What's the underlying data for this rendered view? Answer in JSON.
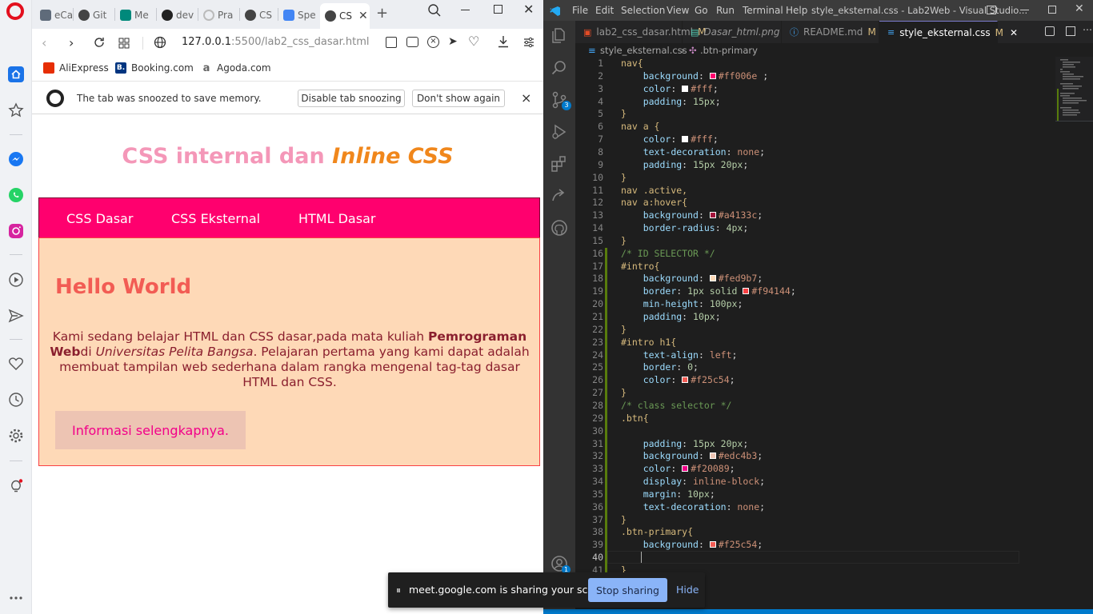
{
  "browser": {
    "tabs": [
      {
        "label": "eCa",
        "color": "#5f6b7a"
      },
      {
        "label": "Git",
        "color": "#444"
      },
      {
        "label": "Me",
        "color": "#00897b"
      },
      {
        "label": "dev",
        "color": "#222"
      },
      {
        "label": "Pra",
        "color": "#999"
      },
      {
        "label": "CS",
        "color": "#444"
      },
      {
        "label": "Spe",
        "color": "#4285f4"
      },
      {
        "label": "CS",
        "color": "#444"
      }
    ],
    "address": {
      "host": "127.0.0.1",
      "rest": ":5500/lab2_css_dasar.html"
    },
    "bookmarks": [
      {
        "label": "AliExpress",
        "icon_color": "#e62e04",
        "letter": "a"
      },
      {
        "label": "Booking.com",
        "icon_color": "#003580",
        "letter": "B."
      },
      {
        "label": "Agoda.com",
        "icon_color": "#777777",
        "letter": "a"
      }
    ],
    "snooze": {
      "message": "The tab was snoozed to save memory.",
      "disable_label": "Disable tab snoozing",
      "dont_show_label": "Don't show again",
      "close_label": "×"
    }
  },
  "page": {
    "title_part1": "CSS internal dan ",
    "title_part2": "Inline CSS",
    "nav": [
      "CSS Dasar",
      "CSS Eksternal",
      "HTML Dasar"
    ],
    "intro_heading": "Hello World",
    "intro_text_1": "Kami sedang belajar HTML dan CSS dasar,pada mata kuliah ",
    "intro_bold": "Pemrograman Web",
    "intro_text_2": "di ",
    "intro_italic": "Universitas Pelita Bangsa",
    "intro_text_3": ". Pelajaran pertama yang kami dapat adalah membuat tampilan web sederhana dalam rangka mengenal tag-tag dasar HTML dan CSS.",
    "intro_button": "Informasi selengkapnya."
  },
  "share": {
    "message": "meet.google.com is sharing your screen.",
    "stop_label": "Stop sharing",
    "hide_label": "Hide"
  },
  "vscode": {
    "menu": [
      "File",
      "Edit",
      "Selection",
      "View",
      "Go",
      "Run",
      "Terminal",
      "Help"
    ],
    "title": "style_eksternal.css - Lab2Web - Visual Studio...",
    "tabs": [
      {
        "label": "lab2_css_dasar.html",
        "mark": "M"
      },
      {
        "label": "Dasar_html.png",
        "mark": ""
      },
      {
        "label": "README.md",
        "mark": "M"
      },
      {
        "label": "style_eksternal.css",
        "mark": "M"
      }
    ],
    "breadcrumb": {
      "file": "style_eksternal.css",
      "symbol": ".btn-primary"
    },
    "source_control_badge": "3",
    "account_badge": "1",
    "lines": [
      [
        "sel",
        "nav{"
      ],
      [
        "decl",
        "background",
        "#ff006e",
        " ;",
        "#ff006e"
      ],
      [
        "decl",
        "color",
        "#fff",
        ";",
        "#ffffff"
      ],
      [
        "decl",
        "padding",
        "15px",
        ";",
        ""
      ],
      [
        "sel",
        "}"
      ],
      [
        "sel",
        "nav a {"
      ],
      [
        "decl",
        "color",
        "#fff",
        ";",
        "#ffffff"
      ],
      [
        "decl",
        "text-decoration",
        "none",
        ";",
        ""
      ],
      [
        "decl",
        "padding",
        "15px 20px",
        ";",
        ""
      ],
      [
        "sel",
        "}"
      ],
      [
        "sel",
        "nav .active,"
      ],
      [
        "sel",
        "nav a:hover{"
      ],
      [
        "decl",
        "background",
        "#a4133c",
        ";",
        "#a4133c"
      ],
      [
        "decl",
        "border-radius",
        "4px",
        ";",
        ""
      ],
      [
        "sel",
        "}"
      ],
      [
        "cmt",
        "/* ID SELECTOR */"
      ],
      [
        "sel",
        "#intro{"
      ],
      [
        "decl",
        "background",
        "#fed9b7",
        ";",
        "#fed9b7"
      ],
      [
        "decl",
        "border",
        "1px solid #f94144",
        ";",
        "#f94144"
      ],
      [
        "decl",
        "min-height",
        "100px",
        ";",
        ""
      ],
      [
        "decl",
        "padding",
        "10px",
        ";",
        ""
      ],
      [
        "sel",
        "}"
      ],
      [
        "sel",
        "#intro h1{"
      ],
      [
        "decl",
        "text-align",
        "left",
        ";",
        ""
      ],
      [
        "decl",
        "border",
        "0",
        ";",
        ""
      ],
      [
        "decl",
        "color",
        "#f25c54",
        ";",
        "#f25c54"
      ],
      [
        "sel",
        "}"
      ],
      [
        "cmt",
        "/* class selector */"
      ],
      [
        "sel",
        ".btn{"
      ],
      [
        "sel",
        ""
      ],
      [
        "decl",
        "padding",
        "15px 20px",
        ";",
        ""
      ],
      [
        "decl",
        "background",
        "#edc4b3",
        ";",
        "#edc4b3"
      ],
      [
        "decl",
        "color",
        "#f20089",
        ";",
        "#f20089"
      ],
      [
        "decl",
        "display",
        "inline-block",
        ";",
        ""
      ],
      [
        "decl",
        "margin",
        "10px",
        ";",
        ""
      ],
      [
        "decl",
        "text-decoration",
        "none",
        ";",
        ""
      ],
      [
        "sel",
        "}"
      ],
      [
        "sel",
        ".btn-primary{"
      ],
      [
        "decl",
        "background",
        "#f25c54",
        ";",
        "#f25c54"
      ],
      [
        "sel",
        ""
      ],
      [
        "sel",
        "}"
      ]
    ]
  }
}
